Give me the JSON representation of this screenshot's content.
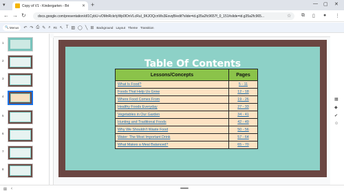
{
  "browser": {
    "tab_title": "Copy of V1 - Kindergarten - Bri",
    "url": "docs.google.com/presentation/d/1CybU-vOMnRckrlyWp0lOnVLcRuI_9KJOQcnWs3ExvqB/edit?slide=id.g35a2fc9657f_0_151#slide=id.g35a2fc965..."
  },
  "toolbar": {
    "menus_label": "Menus",
    "fit_label": "Fit",
    "background_label": "Background",
    "layout_label": "Layout",
    "theme_label": "Theme",
    "transition_label": "Transition"
  },
  "filmstrip": {
    "slides": [
      {
        "num": "1"
      },
      {
        "num": "2"
      },
      {
        "num": "3"
      },
      {
        "num": "4"
      },
      {
        "num": "5"
      },
      {
        "num": "6"
      },
      {
        "num": "7"
      },
      {
        "num": "8"
      }
    ],
    "selected": "4"
  },
  "slide": {
    "title": "Table Of Contents",
    "header_left": "Lessons/Concepts",
    "header_right": "Pages",
    "rows": [
      {
        "lesson": "What Is Food?",
        "pages": "5 - 11"
      },
      {
        "lesson": "Foods That Help Us Grow",
        "pages": "12 - 18"
      },
      {
        "lesson": "Where Food Comes From",
        "pages": "19 - 26"
      },
      {
        "lesson": "Healthy Foods Everyday",
        "pages": "27 - 33"
      },
      {
        "lesson": "Vegetables in Our Garden",
        "pages": "34 - 41"
      },
      {
        "lesson": "Hunting and Traditional Foods",
        "pages": "42 - 49"
      },
      {
        "lesson": "Why We Shouldn't Waste Food",
        "pages": "50 - 56"
      },
      {
        "lesson": "Water: The Most Important Drink",
        "pages": "57 - 64"
      },
      {
        "lesson": "What Makes a Meal Balanced?",
        "pages": "65 - 70"
      }
    ]
  },
  "colors": {
    "slide_frame": "#6b4642",
    "slide_bg": "#8dd1c7",
    "header_green": "#8bc34a",
    "row_peach": "#fde3c3",
    "link_blue": "#1a6fb0"
  }
}
